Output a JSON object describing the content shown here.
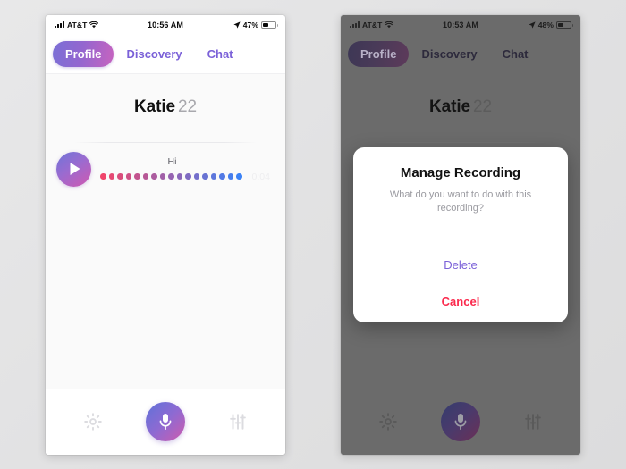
{
  "colors": {
    "accent_purple": "#7b61d8",
    "accent_pink": "#d158b0",
    "cancel_red": "#fb2a4d",
    "page_bg": "#e5e5e6",
    "dim_overlay": "#6b6b6b"
  },
  "phones": [
    {
      "id": "left",
      "dimmed": false,
      "status_bar": {
        "signal_icon": "signal-bars-icon",
        "carrier": "AT&T",
        "wifi_icon": "wifi-icon",
        "clock": "10:56 AM",
        "location_icon": "location-arrow-icon",
        "battery_percent": "47%",
        "battery_icon": "battery-icon",
        "battery_fill": 47
      },
      "tabs": [
        {
          "label": "Profile",
          "active": true
        },
        {
          "label": "Discovery",
          "active": false
        },
        {
          "label": "Chat",
          "active": false
        }
      ],
      "profile": {
        "name": "Katie",
        "age": "22"
      },
      "player": {
        "play_icon": "play-icon",
        "clip_label": "Hi",
        "duration": "0:04",
        "waveform_dots": 17,
        "wave_start_color": "#f0456b",
        "wave_end_color": "#3b82f6"
      },
      "bottom_bar": {
        "settings_icon": "gear-icon",
        "record_icon": "microphone-icon",
        "equalizer_icon": "sliders-icon"
      },
      "modal": null
    },
    {
      "id": "right",
      "dimmed": true,
      "status_bar": {
        "signal_icon": "signal-bars-icon",
        "carrier": "AT&T",
        "wifi_icon": "wifi-icon",
        "clock": "10:53 AM",
        "location_icon": "location-arrow-icon",
        "battery_percent": "48%",
        "battery_icon": "battery-icon",
        "battery_fill": 48
      },
      "tabs": [
        {
          "label": "Profile",
          "active": true
        },
        {
          "label": "Discovery",
          "active": false
        },
        {
          "label": "Chat",
          "active": false
        }
      ],
      "profile": {
        "name": "Katie",
        "age": "22"
      },
      "player": {
        "play_icon": "play-icon",
        "clip_label": "",
        "duration": "",
        "waveform_dots": 0,
        "wave_start_color": "#f0456b",
        "wave_end_color": "#3b82f6"
      },
      "bottom_bar": {
        "settings_icon": "gear-icon",
        "record_icon": "microphone-icon",
        "equalizer_icon": "sliders-icon"
      },
      "modal": {
        "title": "Manage Recording",
        "subtitle": "What do you want to do with this recording?",
        "actions": [
          {
            "label": "Delete",
            "style": "delete"
          },
          {
            "label": "Cancel",
            "style": "cancel"
          }
        ]
      }
    }
  ]
}
